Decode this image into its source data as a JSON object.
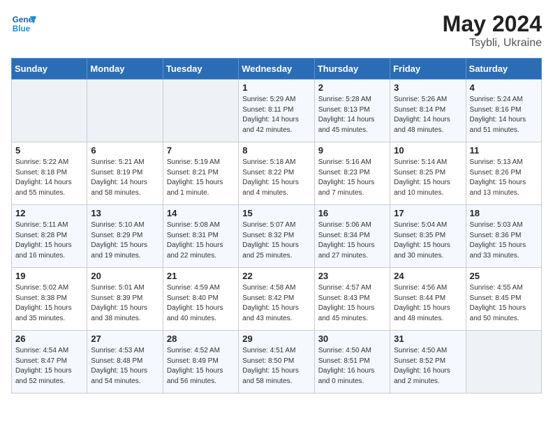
{
  "header": {
    "logo_line1": "General",
    "logo_line2": "Blue",
    "month_year": "May 2024",
    "location": "Tsybli, Ukraine"
  },
  "weekdays": [
    "Sunday",
    "Monday",
    "Tuesday",
    "Wednesday",
    "Thursday",
    "Friday",
    "Saturday"
  ],
  "weeks": [
    [
      {
        "day": "",
        "info": ""
      },
      {
        "day": "",
        "info": ""
      },
      {
        "day": "",
        "info": ""
      },
      {
        "day": "1",
        "info": "Sunrise: 5:29 AM\nSunset: 8:11 PM\nDaylight: 14 hours\nand 42 minutes."
      },
      {
        "day": "2",
        "info": "Sunrise: 5:28 AM\nSunset: 8:13 PM\nDaylight: 14 hours\nand 45 minutes."
      },
      {
        "day": "3",
        "info": "Sunrise: 5:26 AM\nSunset: 8:14 PM\nDaylight: 14 hours\nand 48 minutes."
      },
      {
        "day": "4",
        "info": "Sunrise: 5:24 AM\nSunset: 8:16 PM\nDaylight: 14 hours\nand 51 minutes."
      }
    ],
    [
      {
        "day": "5",
        "info": "Sunrise: 5:22 AM\nSunset: 8:18 PM\nDaylight: 14 hours\nand 55 minutes."
      },
      {
        "day": "6",
        "info": "Sunrise: 5:21 AM\nSunset: 8:19 PM\nDaylight: 14 hours\nand 58 minutes."
      },
      {
        "day": "7",
        "info": "Sunrise: 5:19 AM\nSunset: 8:21 PM\nDaylight: 15 hours\nand 1 minute."
      },
      {
        "day": "8",
        "info": "Sunrise: 5:18 AM\nSunset: 8:22 PM\nDaylight: 15 hours\nand 4 minutes."
      },
      {
        "day": "9",
        "info": "Sunrise: 5:16 AM\nSunset: 8:23 PM\nDaylight: 15 hours\nand 7 minutes."
      },
      {
        "day": "10",
        "info": "Sunrise: 5:14 AM\nSunset: 8:25 PM\nDaylight: 15 hours\nand 10 minutes."
      },
      {
        "day": "11",
        "info": "Sunrise: 5:13 AM\nSunset: 8:26 PM\nDaylight: 15 hours\nand 13 minutes."
      }
    ],
    [
      {
        "day": "12",
        "info": "Sunrise: 5:11 AM\nSunset: 8:28 PM\nDaylight: 15 hours\nand 16 minutes."
      },
      {
        "day": "13",
        "info": "Sunrise: 5:10 AM\nSunset: 8:29 PM\nDaylight: 15 hours\nand 19 minutes."
      },
      {
        "day": "14",
        "info": "Sunrise: 5:08 AM\nSunset: 8:31 PM\nDaylight: 15 hours\nand 22 minutes."
      },
      {
        "day": "15",
        "info": "Sunrise: 5:07 AM\nSunset: 8:32 PM\nDaylight: 15 hours\nand 25 minutes."
      },
      {
        "day": "16",
        "info": "Sunrise: 5:06 AM\nSunset: 8:34 PM\nDaylight: 15 hours\nand 27 minutes."
      },
      {
        "day": "17",
        "info": "Sunrise: 5:04 AM\nSunset: 8:35 PM\nDaylight: 15 hours\nand 30 minutes."
      },
      {
        "day": "18",
        "info": "Sunrise: 5:03 AM\nSunset: 8:36 PM\nDaylight: 15 hours\nand 33 minutes."
      }
    ],
    [
      {
        "day": "19",
        "info": "Sunrise: 5:02 AM\nSunset: 8:38 PM\nDaylight: 15 hours\nand 35 minutes."
      },
      {
        "day": "20",
        "info": "Sunrise: 5:01 AM\nSunset: 8:39 PM\nDaylight: 15 hours\nand 38 minutes."
      },
      {
        "day": "21",
        "info": "Sunrise: 4:59 AM\nSunset: 8:40 PM\nDaylight: 15 hours\nand 40 minutes."
      },
      {
        "day": "22",
        "info": "Sunrise: 4:58 AM\nSunset: 8:42 PM\nDaylight: 15 hours\nand 43 minutes."
      },
      {
        "day": "23",
        "info": "Sunrise: 4:57 AM\nSunset: 8:43 PM\nDaylight: 15 hours\nand 45 minutes."
      },
      {
        "day": "24",
        "info": "Sunrise: 4:56 AM\nSunset: 8:44 PM\nDaylight: 15 hours\nand 48 minutes."
      },
      {
        "day": "25",
        "info": "Sunrise: 4:55 AM\nSunset: 8:45 PM\nDaylight: 15 hours\nand 50 minutes."
      }
    ],
    [
      {
        "day": "26",
        "info": "Sunrise: 4:54 AM\nSunset: 8:47 PM\nDaylight: 15 hours\nand 52 minutes."
      },
      {
        "day": "27",
        "info": "Sunrise: 4:53 AM\nSunset: 8:48 PM\nDaylight: 15 hours\nand 54 minutes."
      },
      {
        "day": "28",
        "info": "Sunrise: 4:52 AM\nSunset: 8:49 PM\nDaylight: 15 hours\nand 56 minutes."
      },
      {
        "day": "29",
        "info": "Sunrise: 4:51 AM\nSunset: 8:50 PM\nDaylight: 15 hours\nand 58 minutes."
      },
      {
        "day": "30",
        "info": "Sunrise: 4:50 AM\nSunset: 8:51 PM\nDaylight: 16 hours\nand 0 minutes."
      },
      {
        "day": "31",
        "info": "Sunrise: 4:50 AM\nSunset: 8:52 PM\nDaylight: 16 hours\nand 2 minutes."
      },
      {
        "day": "",
        "info": ""
      }
    ]
  ]
}
